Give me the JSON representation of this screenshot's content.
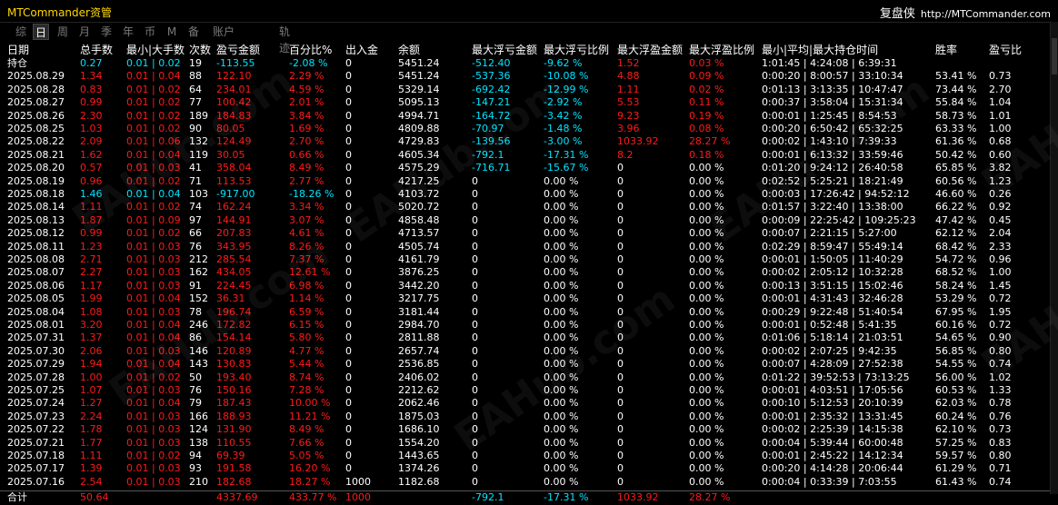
{
  "window": {
    "title": "MTCommander资管",
    "right_label": "复盘侠",
    "right_url": "http://MTCommander.com"
  },
  "tabs": [
    {
      "label": "综",
      "active": false
    },
    {
      "label": "日",
      "active": true
    },
    {
      "label": "周",
      "active": false
    },
    {
      "label": "月",
      "active": false
    },
    {
      "label": "季",
      "active": false
    },
    {
      "label": "年",
      "active": false
    },
    {
      "label": "币",
      "active": false
    },
    {
      "label": "M",
      "active": false
    },
    {
      "label": "备",
      "active": false
    },
    {
      "label": "账户",
      "active": false
    }
  ],
  "tab_trail": "轨迹",
  "watermark": "EAHub.com",
  "colors": {
    "red": "#ff1a1a",
    "cyan": "#00e5ff",
    "yellow": "#ffd700",
    "white": "#ffffff"
  },
  "headers": [
    "日期",
    "总手数",
    "最小|大手数",
    "次数",
    "盈亏金额",
    "百分比%",
    "出入金",
    "余额",
    "最大浮亏金额",
    "最大浮亏比例",
    "最大浮盈金额",
    "最大浮盈比例",
    "最小|平均|最大持仓时间",
    "胜率",
    "盈亏比"
  ],
  "holding": {
    "date": "持仓",
    "lots": "0.27",
    "minmax": "0.01 | 0.02",
    "count": "19",
    "pnl": "-113.55",
    "pct": "-2.08 %",
    "io": "0",
    "bal": "5451.24",
    "fl_amt": "-512.40",
    "fl_pct": "-9.62 %",
    "fp_amt": "1.52",
    "fp_pct": "0.03 %",
    "hold": "1:01:45 | 4:24:08 | 6:39:31",
    "win": "",
    "rr": "",
    "color": "cyan"
  },
  "rows": [
    {
      "date": "2025.08.29",
      "lots": "1.34",
      "minmax": "0.01 | 0.04",
      "count": "88",
      "pnl": "122.10",
      "pct": "2.29 %",
      "io": "0",
      "bal": "5451.24",
      "fl_amt": "-537.36",
      "fl_pct": "-10.08 %",
      "fp_amt": "4.88",
      "fp_pct": "0.09 %",
      "hold": "0:00:20 | 8:00:57 | 33:10:34",
      "win": "53.41 %",
      "rr": "0.73",
      "color": "red"
    },
    {
      "date": "2025.08.28",
      "lots": "0.83",
      "minmax": "0.01 | 0.02",
      "count": "64",
      "pnl": "234.01",
      "pct": "4.59 %",
      "io": "0",
      "bal": "5329.14",
      "fl_amt": "-692.42",
      "fl_pct": "-12.99 %",
      "fp_amt": "1.11",
      "fp_pct": "0.02 %",
      "hold": "0:01:13 | 3:13:35 | 10:47:47",
      "win": "73.44 %",
      "rr": "2.70",
      "color": "red"
    },
    {
      "date": "2025.08.27",
      "lots": "0.99",
      "minmax": "0.01 | 0.02",
      "count": "77",
      "pnl": "100.42",
      "pct": "2.01 %",
      "io": "0",
      "bal": "5095.13",
      "fl_amt": "-147.21",
      "fl_pct": "-2.92 %",
      "fp_amt": "5.53",
      "fp_pct": "0.11 %",
      "hold": "0:00:37 | 3:58:04 | 15:31:34",
      "win": "55.84 %",
      "rr": "1.04",
      "color": "red"
    },
    {
      "date": "2025.08.26",
      "lots": "2.30",
      "minmax": "0.01 | 0.02",
      "count": "189",
      "pnl": "184.83",
      "pct": "3.84 %",
      "io": "0",
      "bal": "4994.71",
      "fl_amt": "-164.72",
      "fl_pct": "-3.42 %",
      "fp_amt": "9.23",
      "fp_pct": "0.19 %",
      "hold": "0:00:01 | 1:25:45 | 8:54:53",
      "win": "58.73 %",
      "rr": "1.01",
      "color": "red"
    },
    {
      "date": "2025.08.25",
      "lots": "1.03",
      "minmax": "0.01 | 0.02",
      "count": "90",
      "pnl": "80.05",
      "pct": "1.69 %",
      "io": "0",
      "bal": "4809.88",
      "fl_amt": "-70.97",
      "fl_pct": "-1.48 %",
      "fp_amt": "3.96",
      "fp_pct": "0.08 %",
      "hold": "0:00:20 | 6:50:42 | 65:32:25",
      "win": "63.33 %",
      "rr": "1.00",
      "color": "red"
    },
    {
      "date": "2025.08.22",
      "lots": "2.09",
      "minmax": "0.01 | 0.06",
      "count": "132",
      "pnl": "124.49",
      "pct": "2.70 %",
      "io": "0",
      "bal": "4729.83",
      "fl_amt": "-139.56",
      "fl_pct": "-3.00 %",
      "fp_amt": "1033.92",
      "fp_pct": "28.27 %",
      "hold": "0:00:02 | 1:43:10 | 7:39:33",
      "win": "61.36 %",
      "rr": "0.68",
      "color": "red"
    },
    {
      "date": "2025.08.21",
      "lots": "1.62",
      "minmax": "0.01 | 0.04",
      "count": "119",
      "pnl": "30.05",
      "pct": "0.66 %",
      "io": "0",
      "bal": "4605.34",
      "fl_amt": "-792.1",
      "fl_pct": "-17.31 %",
      "fp_amt": "8.2",
      "fp_pct": "0.18 %",
      "hold": "0:00:01 | 6:13:32 | 33:59:46",
      "win": "50.42 %",
      "rr": "0.60",
      "color": "red"
    },
    {
      "date": "2025.08.20",
      "lots": "0.57",
      "minmax": "0.01 | 0.03",
      "count": "41",
      "pnl": "358.04",
      "pct": "8.49 %",
      "io": "0",
      "bal": "4575.29",
      "fl_amt": "-716.71",
      "fl_pct": "-15.67 %",
      "fp_amt": "0",
      "fp_pct": "0.00 %",
      "hold": "0:01:20 | 9:24:12 | 26:40:58",
      "win": "65.85 %",
      "rr": "3.82",
      "color": "red"
    },
    {
      "date": "2025.08.19",
      "lots": "0.96",
      "minmax": "0.01 | 0.02",
      "count": "71",
      "pnl": "113.53",
      "pct": "2.77 %",
      "io": "0",
      "bal": "4217.25",
      "fl_amt": "0",
      "fl_pct": "0.00 %",
      "fp_amt": "0",
      "fp_pct": "0.00 %",
      "hold": "0:02:52 | 5:25:21 | 18:21:49",
      "win": "60.56 %",
      "rr": "1.23",
      "color": "red"
    },
    {
      "date": "2025.08.18",
      "lots": "1.46",
      "minmax": "0.01 | 0.04",
      "count": "103",
      "pnl": "-917.00",
      "pct": "-18.26 %",
      "io": "0",
      "bal": "4103.72",
      "fl_amt": "0",
      "fl_pct": "0.00 %",
      "fp_amt": "0",
      "fp_pct": "0.00 %",
      "hold": "0:00:03 | 17:26:42 | 94:52:12",
      "win": "46.60 %",
      "rr": "0.26",
      "color": "cyan"
    },
    {
      "date": "2025.08.14",
      "lots": "1.11",
      "minmax": "0.01 | 0.02",
      "count": "74",
      "pnl": "162.24",
      "pct": "3.34 %",
      "io": "0",
      "bal": "5020.72",
      "fl_amt": "0",
      "fl_pct": "0.00 %",
      "fp_amt": "0",
      "fp_pct": "0.00 %",
      "hold": "0:01:57 | 3:22:40 | 13:38:00",
      "win": "66.22 %",
      "rr": "0.92",
      "color": "red"
    },
    {
      "date": "2025.08.13",
      "lots": "1.87",
      "minmax": "0.01 | 0.09",
      "count": "97",
      "pnl": "144.91",
      "pct": "3.07 %",
      "io": "0",
      "bal": "4858.48",
      "fl_amt": "0",
      "fl_pct": "0.00 %",
      "fp_amt": "0",
      "fp_pct": "0.00 %",
      "hold": "0:00:09 | 22:25:42 | 109:25:23",
      "win": "47.42 %",
      "rr": "0.45",
      "color": "red"
    },
    {
      "date": "2025.08.12",
      "lots": "0.99",
      "minmax": "0.01 | 0.02",
      "count": "66",
      "pnl": "207.83",
      "pct": "4.61 %",
      "io": "0",
      "bal": "4713.57",
      "fl_amt": "0",
      "fl_pct": "0.00 %",
      "fp_amt": "0",
      "fp_pct": "0.00 %",
      "hold": "0:00:07 | 2:21:15 | 5:27:00",
      "win": "62.12 %",
      "rr": "2.04",
      "color": "red"
    },
    {
      "date": "2025.08.11",
      "lots": "1.23",
      "minmax": "0.01 | 0.03",
      "count": "76",
      "pnl": "343.95",
      "pct": "8.26 %",
      "io": "0",
      "bal": "4505.74",
      "fl_amt": "0",
      "fl_pct": "0.00 %",
      "fp_amt": "0",
      "fp_pct": "0.00 %",
      "hold": "0:02:29 | 8:59:47 | 55:49:14",
      "win": "68.42 %",
      "rr": "2.33",
      "color": "red"
    },
    {
      "date": "2025.08.08",
      "lots": "2.71",
      "minmax": "0.01 | 0.03",
      "count": "212",
      "pnl": "285.54",
      "pct": "7.37 %",
      "io": "0",
      "bal": "4161.79",
      "fl_amt": "0",
      "fl_pct": "0.00 %",
      "fp_amt": "0",
      "fp_pct": "0.00 %",
      "hold": "0:00:01 | 1:50:05 | 11:40:29",
      "win": "54.72 %",
      "rr": "0.96",
      "color": "red"
    },
    {
      "date": "2025.08.07",
      "lots": "2.27",
      "minmax": "0.01 | 0.03",
      "count": "162",
      "pnl": "434.05",
      "pct": "12.61 %",
      "io": "0",
      "bal": "3876.25",
      "fl_amt": "0",
      "fl_pct": "0.00 %",
      "fp_amt": "0",
      "fp_pct": "0.00 %",
      "hold": "0:00:02 | 2:05:12 | 10:32:28",
      "win": "68.52 %",
      "rr": "1.00",
      "color": "red"
    },
    {
      "date": "2025.08.06",
      "lots": "1.17",
      "minmax": "0.01 | 0.03",
      "count": "91",
      "pnl": "224.45",
      "pct": "6.98 %",
      "io": "0",
      "bal": "3442.20",
      "fl_amt": "0",
      "fl_pct": "0.00 %",
      "fp_amt": "0",
      "fp_pct": "0.00 %",
      "hold": "0:00:13 | 3:51:15 | 15:02:46",
      "win": "58.24 %",
      "rr": "1.45",
      "color": "red"
    },
    {
      "date": "2025.08.05",
      "lots": "1.99",
      "minmax": "0.01 | 0.04",
      "count": "152",
      "pnl": "36.31",
      "pct": "1.14 %",
      "io": "0",
      "bal": "3217.75",
      "fl_amt": "0",
      "fl_pct": "0.00 %",
      "fp_amt": "0",
      "fp_pct": "0.00 %",
      "hold": "0:00:01 | 4:31:43 | 32:46:28",
      "win": "53.29 %",
      "rr": "0.72",
      "color": "red"
    },
    {
      "date": "2025.08.04",
      "lots": "1.08",
      "minmax": "0.01 | 0.03",
      "count": "78",
      "pnl": "196.74",
      "pct": "6.59 %",
      "io": "0",
      "bal": "3181.44",
      "fl_amt": "0",
      "fl_pct": "0.00 %",
      "fp_amt": "0",
      "fp_pct": "0.00 %",
      "hold": "0:00:29 | 9:22:48 | 51:40:54",
      "win": "67.95 %",
      "rr": "1.95",
      "color": "red"
    },
    {
      "date": "2025.08.01",
      "lots": "3.20",
      "minmax": "0.01 | 0.04",
      "count": "246",
      "pnl": "172.82",
      "pct": "6.15 %",
      "io": "0",
      "bal": "2984.70",
      "fl_amt": "0",
      "fl_pct": "0.00 %",
      "fp_amt": "0",
      "fp_pct": "0.00 %",
      "hold": "0:00:01 | 0:52:48 | 5:41:35",
      "win": "60.16 %",
      "rr": "0.72",
      "color": "red"
    },
    {
      "date": "2025.07.31",
      "lots": "1.37",
      "minmax": "0.01 | 0.04",
      "count": "86",
      "pnl": "154.14",
      "pct": "5.80 %",
      "io": "0",
      "bal": "2811.88",
      "fl_amt": "0",
      "fl_pct": "0.00 %",
      "fp_amt": "0",
      "fp_pct": "0.00 %",
      "hold": "0:01:06 | 5:18:14 | 21:03:51",
      "win": "54.65 %",
      "rr": "0.90",
      "color": "red"
    },
    {
      "date": "2025.07.30",
      "lots": "2.06",
      "minmax": "0.01 | 0.03",
      "count": "146",
      "pnl": "120.89",
      "pct": "4.77 %",
      "io": "0",
      "bal": "2657.74",
      "fl_amt": "0",
      "fl_pct": "0.00 %",
      "fp_amt": "0",
      "fp_pct": "0.00 %",
      "hold": "0:00:02 | 2:07:25 | 9:42:35",
      "win": "56.85 %",
      "rr": "0.80",
      "color": "red"
    },
    {
      "date": "2025.07.29",
      "lots": "1.94",
      "minmax": "0.01 | 0.04",
      "count": "143",
      "pnl": "130.83",
      "pct": "5.44 %",
      "io": "0",
      "bal": "2536.85",
      "fl_amt": "0",
      "fl_pct": "0.00 %",
      "fp_amt": "0",
      "fp_pct": "0.00 %",
      "hold": "0:00:07 | 4:28:09 | 27:52:38",
      "win": "54.55 %",
      "rr": "0.74",
      "color": "red"
    },
    {
      "date": "2025.07.28",
      "lots": "1.00",
      "minmax": "0.01 | 0.02",
      "count": "50",
      "pnl": "193.40",
      "pct": "8.74 %",
      "io": "0",
      "bal": "2406.02",
      "fl_amt": "0",
      "fl_pct": "0.00 %",
      "fp_amt": "0",
      "fp_pct": "0.00 %",
      "hold": "0:01:22 | 39:52:53 | 73:13:25",
      "win": "56.00 %",
      "rr": "1.02",
      "color": "red"
    },
    {
      "date": "2025.07.25",
      "lots": "1.07",
      "minmax": "0.01 | 0.03",
      "count": "76",
      "pnl": "150.16",
      "pct": "7.28 %",
      "io": "0",
      "bal": "2212.62",
      "fl_amt": "0",
      "fl_pct": "0.00 %",
      "fp_amt": "0",
      "fp_pct": "0.00 %",
      "hold": "0:00:01 | 4:03:51 | 17:05:56",
      "win": "60.53 %",
      "rr": "1.33",
      "color": "red"
    },
    {
      "date": "2025.07.24",
      "lots": "1.27",
      "minmax": "0.01 | 0.04",
      "count": "79",
      "pnl": "187.43",
      "pct": "10.00 %",
      "io": "0",
      "bal": "2062.46",
      "fl_amt": "0",
      "fl_pct": "0.00 %",
      "fp_amt": "0",
      "fp_pct": "0.00 %",
      "hold": "0:00:10 | 5:12:53 | 20:10:39",
      "win": "62.03 %",
      "rr": "0.78",
      "color": "red"
    },
    {
      "date": "2025.07.23",
      "lots": "2.24",
      "minmax": "0.01 | 0.03",
      "count": "166",
      "pnl": "188.93",
      "pct": "11.21 %",
      "io": "0",
      "bal": "1875.03",
      "fl_amt": "0",
      "fl_pct": "0.00 %",
      "fp_amt": "0",
      "fp_pct": "0.00 %",
      "hold": "0:00:01 | 2:35:32 | 13:31:45",
      "win": "60.24 %",
      "rr": "0.76",
      "color": "red"
    },
    {
      "date": "2025.07.22",
      "lots": "1.78",
      "minmax": "0.01 | 0.03",
      "count": "124",
      "pnl": "131.90",
      "pct": "8.49 %",
      "io": "0",
      "bal": "1686.10",
      "fl_amt": "0",
      "fl_pct": "0.00 %",
      "fp_amt": "0",
      "fp_pct": "0.00 %",
      "hold": "0:00:02 | 2:25:39 | 14:15:38",
      "win": "62.10 %",
      "rr": "0.73",
      "color": "red"
    },
    {
      "date": "2025.07.21",
      "lots": "1.77",
      "minmax": "0.01 | 0.03",
      "count": "138",
      "pnl": "110.55",
      "pct": "7.66 %",
      "io": "0",
      "bal": "1554.20",
      "fl_amt": "0",
      "fl_pct": "0.00 %",
      "fp_amt": "0",
      "fp_pct": "0.00 %",
      "hold": "0:00:04 | 5:39:44 | 60:00:48",
      "win": "57.25 %",
      "rr": "0.83",
      "color": "red"
    },
    {
      "date": "2025.07.18",
      "lots": "1.11",
      "minmax": "0.01 | 0.02",
      "count": "94",
      "pnl": "69.39",
      "pct": "5.05 %",
      "io": "0",
      "bal": "1443.65",
      "fl_amt": "0",
      "fl_pct": "0.00 %",
      "fp_amt": "0",
      "fp_pct": "0.00 %",
      "hold": "0:00:01 | 2:45:22 | 14:12:34",
      "win": "59.57 %",
      "rr": "0.80",
      "color": "red"
    },
    {
      "date": "2025.07.17",
      "lots": "1.39",
      "minmax": "0.01 | 0.03",
      "count": "93",
      "pnl": "191.58",
      "pct": "16.20 %",
      "io": "0",
      "bal": "1374.26",
      "fl_amt": "0",
      "fl_pct": "0.00 %",
      "fp_amt": "0",
      "fp_pct": "0.00 %",
      "hold": "0:00:20 | 4:14:28 | 20:06:44",
      "win": "61.29 %",
      "rr": "0.71",
      "color": "red"
    },
    {
      "date": "2025.07.16",
      "lots": "2.54",
      "minmax": "0.01 | 0.03",
      "count": "210",
      "pnl": "182.68",
      "pct": "18.27 %",
      "io": "1000",
      "bal": "1182.68",
      "fl_amt": "0",
      "fl_pct": "0.00 %",
      "fp_amt": "0",
      "fp_pct": "0.00 %",
      "hold": "0:00:04 | 0:33:39 | 7:03:55",
      "win": "61.43 %",
      "rr": "0.74",
      "color": "red"
    }
  ],
  "total": {
    "date": "合计",
    "lots": "50.64",
    "minmax": "",
    "count": "",
    "pnl": "4337.69",
    "pct": "433.77 %",
    "io": "1000",
    "bal": "",
    "fl_amt": "-792.1",
    "fl_pct": "-17.31 %",
    "fp_amt": "1033.92",
    "fp_pct": "28.27 %",
    "hold": "",
    "win": "",
    "rr": ""
  }
}
